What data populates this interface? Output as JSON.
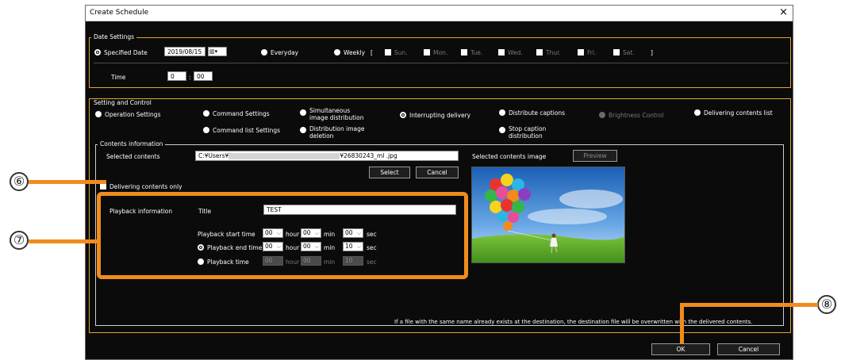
{
  "window": {
    "title": "Create Schedule",
    "close": "×"
  },
  "date_settings": {
    "legend": "Date Settings",
    "specified_date_label": "Specified Date",
    "date_value": "2019/08/15",
    "everyday_label": "Everyday",
    "weekly_label": "Weekly",
    "bracket_open": "[",
    "bracket_close": "]",
    "days": [
      "Sun.",
      "Mon.",
      "Tue.",
      "Wed.",
      "Thur.",
      "Fri.",
      "Sat."
    ],
    "time_label": "Time",
    "hour_value": "0",
    "time_sep": ":",
    "minute_value": "00"
  },
  "setting_control": {
    "legend": "Setting and Control",
    "operation_settings": "Operation Settings",
    "command_settings": "Command Settings",
    "command_list_settings": "Command list Settings",
    "simultaneous_1": "Simultaneous",
    "simultaneous_2": "image distribution",
    "distribution_deletion_1": "Distribution image",
    "distribution_deletion_2": "deletion",
    "interrupting_delivery": "Interrupting delivery",
    "distribute_captions": "Distribute captions",
    "stop_caption_1": "Stop caption",
    "stop_caption_2": "distribution",
    "brightness_control": "Brightness Control",
    "delivering_contents_list": "Delivering contents list"
  },
  "contents": {
    "legend": "Contents information",
    "selected_contents_label": "Selected contents",
    "path_start": "C:¥Users¥",
    "path_end": "¥26830243_ml .jpg",
    "select_button": "Select",
    "cancel_button": "Cancel",
    "selected_image_label": "Selected contents image",
    "preview_button": "Preview",
    "delivering_only_label": "Delivering contents only"
  },
  "playback": {
    "info_label": "Playback information",
    "title_label": "Title",
    "title_value": "TEST",
    "start_time_label": "Playback start time",
    "end_time_label": "Playback end time",
    "playback_time_label": "Playback time",
    "hour_unit": "hour",
    "min_unit": "min",
    "sec_unit": "sec",
    "start": {
      "h": "00",
      "m": "00",
      "s": "00"
    },
    "end": {
      "h": "00",
      "m": "00",
      "s": "10"
    },
    "duration": {
      "h": "00",
      "m": "00",
      "s": "10"
    }
  },
  "notice": "If a file with the same name already exists at the destination, the destination file will be overwritten with the delivered contents.",
  "footer": {
    "ok": "OK",
    "cancel": "Cancel"
  },
  "callouts": {
    "six": "⑥",
    "seven": "⑦",
    "eight": "⑧"
  },
  "colors": {
    "accent_orange": "#f08c1e",
    "group_border": "#e0a62e",
    "window_bg": "#0b0b0b"
  }
}
